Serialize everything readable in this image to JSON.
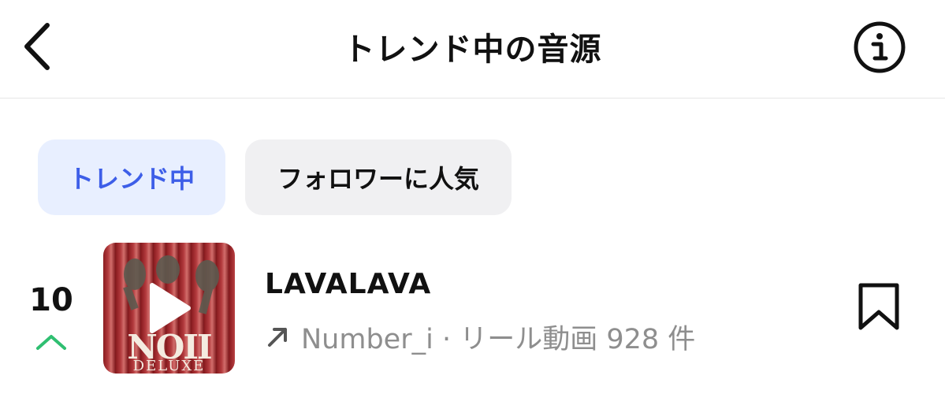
{
  "header": {
    "title": "トレンド中の音源",
    "back_icon": "chevron-left-icon",
    "info_icon": "info-circle-icon"
  },
  "tabs": [
    {
      "label": "トレンド中",
      "active": true
    },
    {
      "label": "フォロワーに人気",
      "active": false
    }
  ],
  "track": {
    "rank": "10",
    "rank_trend": "up",
    "cover_art": {
      "line1": "NOII",
      "line2": "DELUXE"
    },
    "title": "LAVALAVA",
    "meta": "Number_i · リール動画 928 件",
    "meta_icon": "trending-arrow-icon",
    "bookmark_icon": "bookmark-icon"
  },
  "colors": {
    "accent": "#3d5ee8",
    "active_tab_bg": "#e8efff",
    "inactive_tab_bg": "#f0f0f2",
    "secondary_text": "#8e8e8e",
    "trend_up": "#2fbf71"
  }
}
